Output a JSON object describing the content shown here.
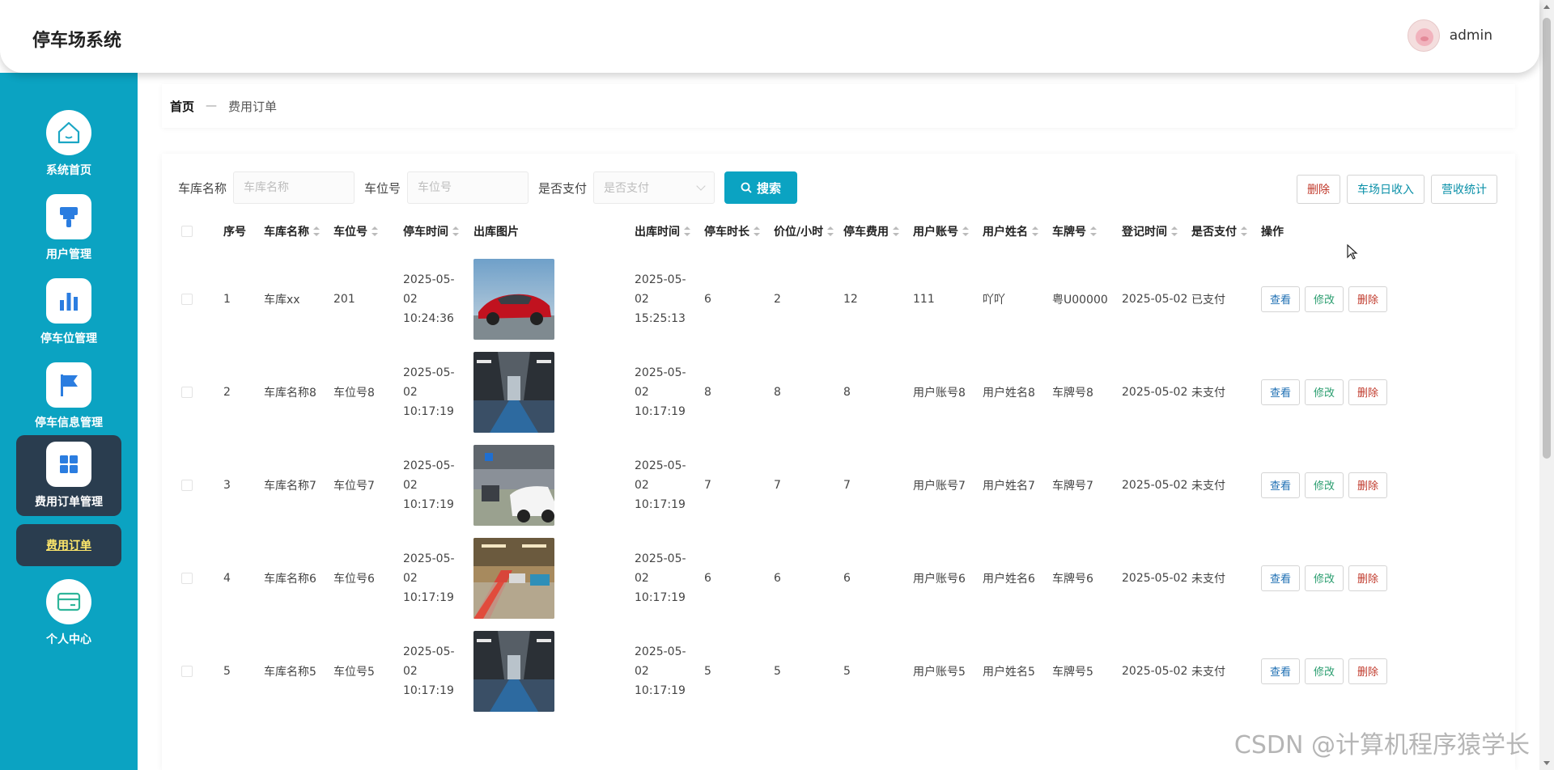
{
  "header": {
    "title": "停车场系统",
    "username": "admin"
  },
  "sidebar": {
    "items": [
      {
        "label": "系统首页",
        "icon": "home-icon"
      },
      {
        "label": "用户管理",
        "icon": "brush-icon"
      },
      {
        "label": "停车位管理",
        "icon": "bar-chart-icon"
      },
      {
        "label": "停车信息管理",
        "icon": "flag-icon"
      },
      {
        "label": "费用订单管理",
        "icon": "grid-icon"
      },
      {
        "label": "个人中心",
        "icon": "card-icon"
      }
    ],
    "sub_item": "费用订单"
  },
  "breadcrumb": {
    "home": "首页",
    "sep": "—",
    "current": "费用订单"
  },
  "search": {
    "garage_label": "车库名称",
    "garage_placeholder": "车库名称",
    "slot_label": "车位号",
    "slot_placeholder": "车位号",
    "paid_label": "是否支付",
    "paid_placeholder": "是否支付",
    "button": "搜索"
  },
  "actions": {
    "delete": "删除",
    "daily_income": "车场日收入",
    "revenue_stats": "营收统计"
  },
  "table": {
    "headers": [
      "序号",
      "车库名称",
      "车位号",
      "停车时间",
      "出库图片",
      "出库时间",
      "停车时长",
      "价位/小时",
      "停车费用",
      "用户账号",
      "用户姓名",
      "车牌号",
      "登记时间",
      "是否支付",
      "操作"
    ],
    "op_labels": {
      "view": "查看",
      "edit": "修改",
      "delete": "删除"
    },
    "rows": [
      {
        "no": "1",
        "garage": "车库xx",
        "slot": "201",
        "park_date": "2025-05-02",
        "park_time": "10:24:36",
        "out_date": "2025-05-02",
        "out_time": "15:25:13",
        "duration": "6",
        "price": "2",
        "fee": "12",
        "account": "111",
        "name": "吖吖",
        "plate": "粤U00000",
        "reg": "2025-05-02",
        "paid": "已支付"
      },
      {
        "no": "2",
        "garage": "车库名称8",
        "slot": "车位号8",
        "park_date": "2025-05-02",
        "park_time": "10:17:19",
        "out_date": "2025-05-02",
        "out_time": "10:17:19",
        "duration": "8",
        "price": "8",
        "fee": "8",
        "account": "用户账号8",
        "name": "用户姓名8",
        "plate": "车牌号8",
        "reg": "2025-05-02",
        "paid": "未支付"
      },
      {
        "no": "3",
        "garage": "车库名称7",
        "slot": "车位号7",
        "park_date": "2025-05-02",
        "park_time": "10:17:19",
        "out_date": "2025-05-02",
        "out_time": "10:17:19",
        "duration": "7",
        "price": "7",
        "fee": "7",
        "account": "用户账号7",
        "name": "用户姓名7",
        "plate": "车牌号7",
        "reg": "2025-05-02",
        "paid": "未支付"
      },
      {
        "no": "4",
        "garage": "车库名称6",
        "slot": "车位号6",
        "park_date": "2025-05-02",
        "park_time": "10:17:19",
        "out_date": "2025-05-02",
        "out_time": "10:17:19",
        "duration": "6",
        "price": "6",
        "fee": "6",
        "account": "用户账号6",
        "name": "用户姓名6",
        "plate": "车牌号6",
        "reg": "2025-05-02",
        "paid": "未支付"
      },
      {
        "no": "5",
        "garage": "车库名称5",
        "slot": "车位号5",
        "park_date": "2025-05-02",
        "park_time": "10:17:19",
        "out_date": "2025-05-02",
        "out_time": "10:17:19",
        "duration": "5",
        "price": "5",
        "fee": "5",
        "account": "用户账号5",
        "name": "用户姓名5",
        "plate": "车牌号5",
        "reg": "2025-05-02",
        "paid": "未支付"
      }
    ]
  },
  "watermark": "CSDN @计算机程序猿学长",
  "colors": {
    "accent": "#0ba3c2",
    "sidebar_active": "#2a3d4f",
    "danger": "#c0392b"
  }
}
